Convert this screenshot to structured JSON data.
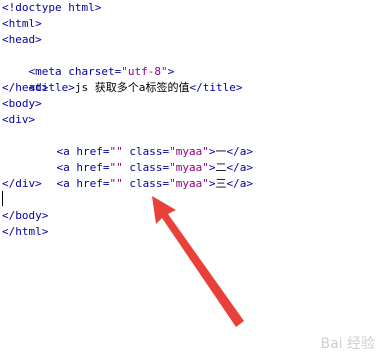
{
  "code": {
    "line1": "<!doctype html>",
    "line2": "<html>",
    "line3": "<head>",
    "line4_open": "<meta charset=",
    "line4_value": "\"utf-8\"",
    "line4_close": ">",
    "line5_open": "<title>",
    "line5_text_js": "js ",
    "line5_text_cjk": "获取多个a标签的值",
    "line5_close": "</title>",
    "line6": "</head>",
    "line7": "<body>",
    "line8": "<div>",
    "anchor_open": "<a href=",
    "anchor_href_val": "\"\"",
    "anchor_class_attr": " class=",
    "anchor_class_val": "\"myaa\"",
    "anchor_gt": ">",
    "anchor_close": "</a>",
    "anchor1_text": "一",
    "anchor2_text": "二",
    "anchor3_text": "三",
    "line12": "</div>",
    "line14": "</body>",
    "line15": "</html>"
  },
  "watermark": "Bai 经验",
  "colors": {
    "tag": "#0000a0",
    "attribute_value": "#8b008b",
    "arrow": "#e8413a"
  }
}
